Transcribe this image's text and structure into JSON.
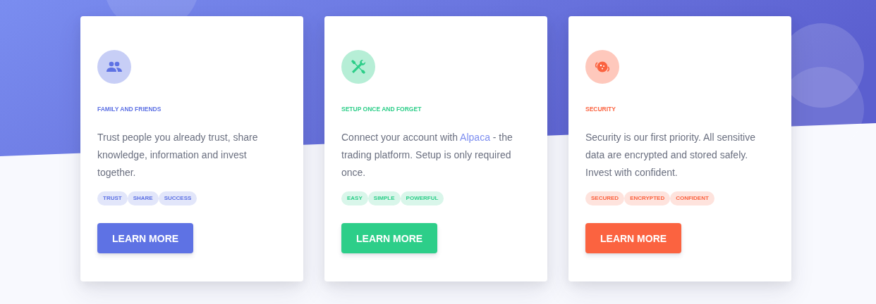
{
  "cards": [
    {
      "color": "#5e72e4",
      "title": "FAMILY AND FRIENDS",
      "description": [
        {
          "kind": "text",
          "text": "Trust people you already trust, share knowledge, information and invest together."
        }
      ],
      "tags": [
        "TRUST",
        "SHARE",
        "SUCCESS"
      ],
      "button": "LEARN MORE"
    },
    {
      "color": "#2dce89",
      "title": "SETUP ONCE AND FORGET",
      "description": [
        {
          "kind": "text",
          "text": "Connect your account with "
        },
        {
          "kind": "link",
          "text": "Alpaca"
        },
        {
          "kind": "text",
          "text": " - the trading platform. Setup is only required once."
        }
      ],
      "tags": [
        "EASY",
        "SIMPLE",
        "POWERFUL"
      ],
      "button": "LEARN MORE"
    },
    {
      "color": "#fb6340",
      "title": "SECURITY",
      "description": [
        {
          "kind": "text",
          "text": "Security is our first priority. All sensitive data are encrypted and stored safely. Invest with confident."
        }
      ],
      "tags": [
        "SECURED",
        "ENCRYPTED",
        "CONFIDENT"
      ],
      "button": "LEARN MORE"
    }
  ]
}
